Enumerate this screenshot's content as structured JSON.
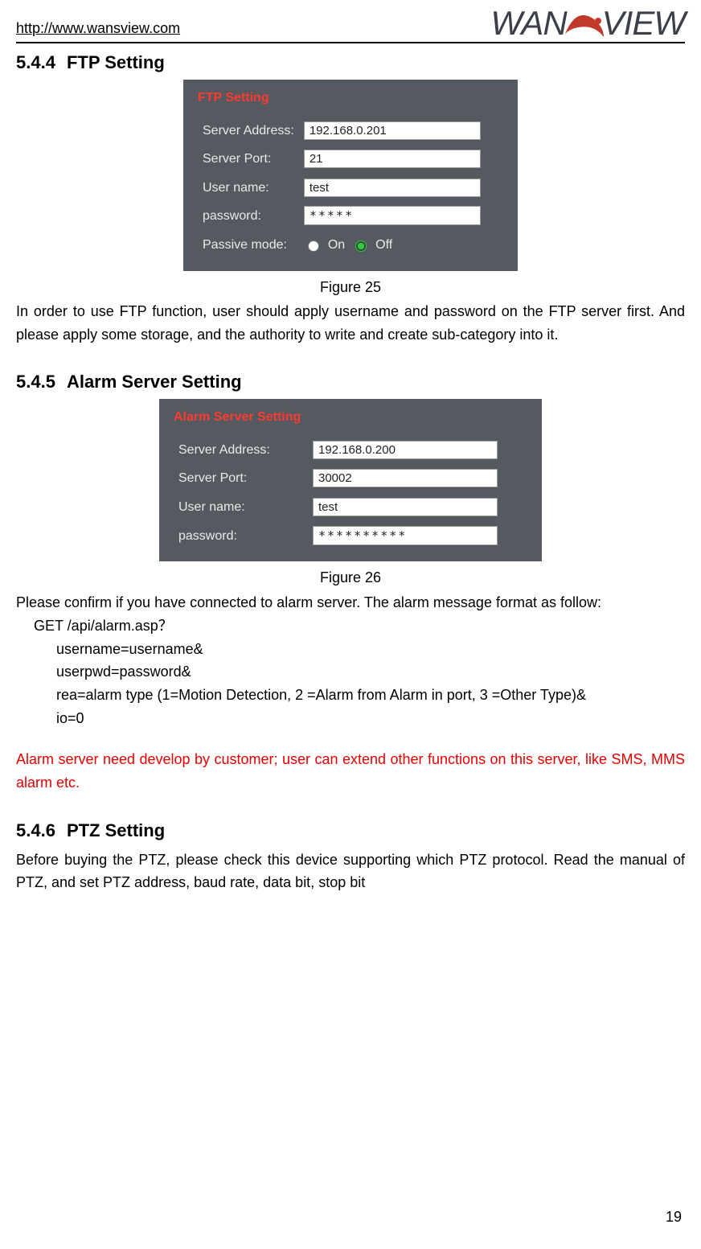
{
  "header": {
    "url": "http://www.wansview.com",
    "brand_left": "WAN",
    "brand_right": "VIEW"
  },
  "section_ftp": {
    "num": "5.4.4",
    "title": "FTP Setting",
    "panel_title": "FTP Setting",
    "server_address_label": "Server Address:",
    "server_address_value": "192.168.0.201",
    "server_port_label": "Server Port:",
    "server_port_value": "21",
    "username_label": "User name:",
    "username_value": "test",
    "password_label": "password:",
    "password_value": "*****",
    "passive_label": "Passive mode:",
    "passive_on": "On",
    "passive_off": "Off",
    "passive_selected": "Off",
    "caption": "Figure 25",
    "desc": "In order to use FTP function, user should apply username and password on the FTP server first. And please apply some storage, and the authority to write and create sub-category into it."
  },
  "section_alarm": {
    "num": "5.4.5",
    "title": "Alarm Server Setting",
    "panel_title": "Alarm Server Setting",
    "server_address_label": "Server Address:",
    "server_address_value": "192.168.0.200",
    "server_port_label": "Server Port:",
    "server_port_value": "30002",
    "username_label": "User name:",
    "username_value": "test",
    "password_label": "password:",
    "password_value": "**********",
    "caption": "Figure 26",
    "desc_intro": "Please confirm if you have connected to alarm server. The alarm message format as follow:",
    "line1": "GET /api/alarm.asp？",
    "line2": "username=username&",
    "line3": "userpwd=password&",
    "line4": "rea=alarm type (1=Motion Detection, 2 =Alarm from Alarm in port, 3 =Other Type)&",
    "line5": "io=0",
    "red_note": "Alarm server need develop by customer; user can extend other functions on this server, like SMS, MMS alarm etc."
  },
  "section_ptz": {
    "num": "5.4.6",
    "title": "PTZ Setting",
    "desc": "Before buying the PTZ, please check this device supporting which PTZ protocol. Read the manual of PTZ, and set PTZ address, baud rate, data bit, stop bit"
  },
  "page_number": "19"
}
